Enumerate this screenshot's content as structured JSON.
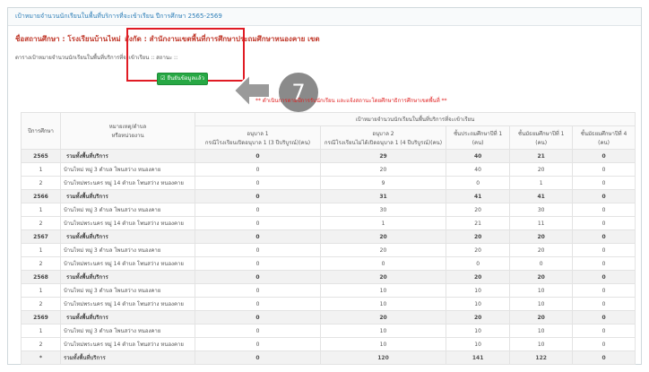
{
  "page": {
    "title": "เป้าหมายจำนวนนักเรียนในพื้นที่บริการที่จะเข้าเรียน ปีการศึกษา 2565-2569"
  },
  "header": {
    "school_label": "ชื่อสถานศึกษา : โรงเรียนบ้านไหม่",
    "area_label": "สังกัด : สำนักงานเขตพื้นที่การศึกษาประถมศึกษาหนองคาย เขต",
    "status_label": "ตารางเป้าหมายจำนวนนักเรียนในพื้นที่บริการที่จะเข้าเรียน :: สถานะ ::",
    "confirm_button": "ยืนยันข้อมูลแล้ว",
    "confirm_icon": "check-square-icon",
    "step_number": "7",
    "note": "** ดำเนินการตามปีการรับนักเรียน และแจ้งสถานะโดยศึกษาธิการศึกษาเขตพื้นที่ **"
  },
  "colors": {
    "accent_blue": "#2e7fb8",
    "highlight_red": "#e01b24",
    "button_green": "#27a844",
    "step_gray": "#8a8a8a"
  },
  "table": {
    "group_header": "เป้าหมายจำนวนนักเรียนในพื้นที่บริการที่จะเข้าเรียน",
    "columns": [
      "ปีการศึกษา",
      "หมายเหตุ/ตำบล\nหรือหน่วยงาน",
      "อนุบาล 1\nกรณีโรงเรียนเปิดอนุบาล 1 (3 ปีบริบูรณ์)(คน)",
      "อนุบาล 2\nกรณีโรงเรียนไม่ได้เปิดอนุบาล 1 (4 ปีบริบูรณ์)(คน)",
      "ชั้นประถมศึกษาปีที่ 1 (คน)",
      "ชั้นมัธยมศึกษาปีที่ 1 (คน)",
      "ชั้นมัธยมศึกษาปีที่ 4 (คน)"
    ],
    "rows": [
      {
        "type": "summary",
        "cells": [
          "2565",
          "รวมทั้งพื้นที่บริการ",
          "0",
          "29",
          "40",
          "21",
          "0"
        ]
      },
      {
        "type": "detail",
        "cells": [
          "1",
          "บ้านไหม่ หมู่ 3 ตำบล โพนสว่าง หนองคาย",
          "0",
          "20",
          "40",
          "20",
          "0"
        ]
      },
      {
        "type": "detail",
        "cells": [
          "2",
          "บ้านไหม่พระนคร หมู่ 14 ตำบล โพนสว่าง หนองคาย",
          "0",
          "9",
          "0",
          "1",
          "0"
        ]
      },
      {
        "type": "summary",
        "cells": [
          "2566",
          "รวมทั้งพื้นที่บริการ",
          "0",
          "31",
          "41",
          "41",
          "0"
        ]
      },
      {
        "type": "detail",
        "cells": [
          "1",
          "บ้านไหม่ หมู่ 3 ตำบล โพนสว่าง หนองคาย",
          "0",
          "30",
          "20",
          "30",
          "0"
        ]
      },
      {
        "type": "detail",
        "cells": [
          "2",
          "บ้านไหม่พระนคร หมู่ 14 ตำบล โพนสว่าง หนองคาย",
          "0",
          "1",
          "21",
          "11",
          "0"
        ]
      },
      {
        "type": "summary",
        "cells": [
          "2567",
          "รวมทั้งพื้นที่บริการ",
          "0",
          "20",
          "20",
          "20",
          "0"
        ]
      },
      {
        "type": "detail",
        "cells": [
          "1",
          "บ้านไหม่ หมู่ 3 ตำบล โพนสว่าง หนองคาย",
          "0",
          "20",
          "20",
          "20",
          "0"
        ]
      },
      {
        "type": "detail",
        "cells": [
          "2",
          "บ้านไหม่พระนคร หมู่ 14 ตำบล โพนสว่าง หนองคาย",
          "0",
          "0",
          "0",
          "0",
          "0"
        ]
      },
      {
        "type": "summary",
        "cells": [
          "2568",
          "รวมทั้งพื้นที่บริการ",
          "0",
          "20",
          "20",
          "20",
          "0"
        ]
      },
      {
        "type": "detail",
        "cells": [
          "1",
          "บ้านไหม่ หมู่ 3 ตำบล โพนสว่าง หนองคาย",
          "0",
          "10",
          "10",
          "10",
          "0"
        ]
      },
      {
        "type": "detail",
        "cells": [
          "2",
          "บ้านไหม่พระนคร หมู่ 14 ตำบล โพนสว่าง หนองคาย",
          "0",
          "10",
          "10",
          "10",
          "0"
        ]
      },
      {
        "type": "summary",
        "cells": [
          "2569",
          "รวมทั้งพื้นที่บริการ",
          "0",
          "20",
          "20",
          "20",
          "0"
        ]
      },
      {
        "type": "detail",
        "cells": [
          "1",
          "บ้านไหม่ หมู่ 3 ตำบล โพนสว่าง หนองคาย",
          "0",
          "10",
          "10",
          "10",
          "0"
        ]
      },
      {
        "type": "detail",
        "cells": [
          "2",
          "บ้านไหม่พระนคร หมู่ 14 ตำบล โพนสว่าง หนองคาย",
          "0",
          "10",
          "10",
          "10",
          "0"
        ]
      },
      {
        "type": "total",
        "cells": [
          "*",
          "รวมทั้งพื้นที่บริการ",
          "0",
          "120",
          "141",
          "122",
          "0"
        ]
      }
    ]
  }
}
